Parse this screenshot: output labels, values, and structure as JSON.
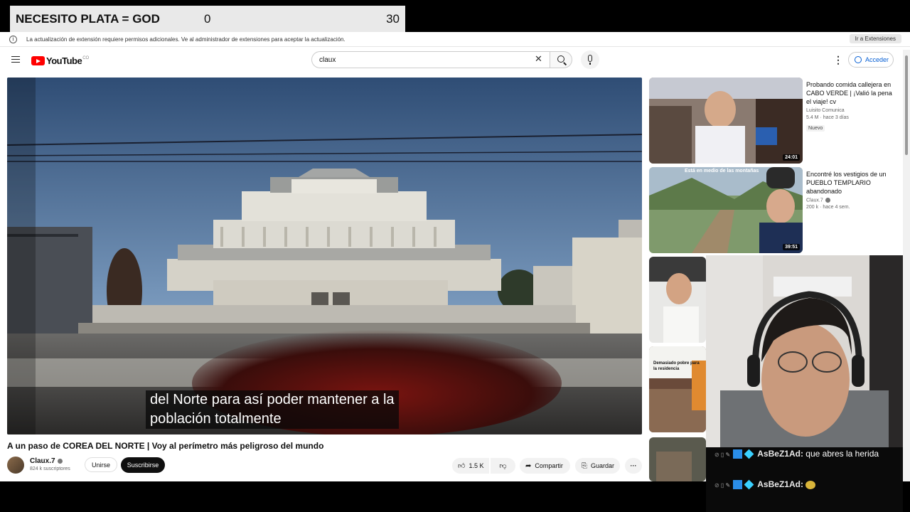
{
  "goal": {
    "title": "NECESITO PLATA = GOD",
    "current": "0",
    "target": "30"
  },
  "infobar": {
    "message": "La actualización de extensión requiere permisos adicionales. Ve al administrador de extensiones para aceptar la actualización.",
    "button": "Ir a Extensiones"
  },
  "header": {
    "logo": "YouTube",
    "search_value": "claux",
    "signin": "Acceder",
    "icons": [
      "menu-icon",
      "search-icon",
      "close-icon",
      "mic-icon",
      "more-vert-icon",
      "account-icon"
    ]
  },
  "player": {
    "subtitle_line1": "del Norte para así poder mantener a la",
    "subtitle_line2": "población totalmente"
  },
  "video": {
    "title": "A un paso de COREA DEL NORTE | Voy al perímetro más peligroso del mundo",
    "channel": "Claux.7",
    "subscribers": "824 k suscriptores",
    "join": "Unirse",
    "subscribe": "Suscribirse",
    "likes": "1.5 K",
    "share": "Compartir",
    "save": "Guardar"
  },
  "recommendations": [
    {
      "title": "Probando comida callejera en CABO VERDE | ¡Valió la pena el viaje! cv",
      "channel": "Luisito Comunica",
      "stats": "5.4 M · hace 3 días",
      "badge": "Nuevo",
      "duration": "24:01"
    },
    {
      "title": "Encontré los vestigios de un PUEBLO TEMPLARIO abandonado",
      "channel": "Claux.7",
      "stats": "200 k · hace 4 sem.",
      "duration": "39:51",
      "thumb_text": "Está en medio de las montañas"
    },
    {
      "thumb_text": "Demasiado pobre para la residencia"
    }
  ],
  "chat": [
    {
      "user": "AsBeZ1Ad:",
      "message": "que abres la herida"
    },
    {
      "user": "AsBeZ1Ad:",
      "message": ""
    }
  ]
}
